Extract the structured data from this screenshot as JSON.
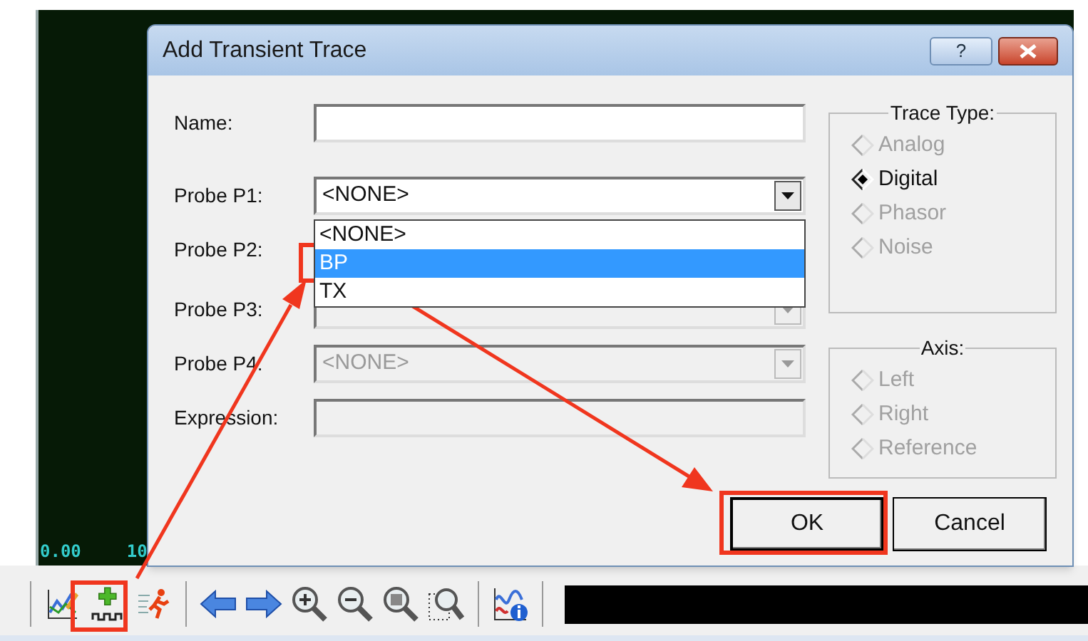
{
  "plot": {
    "x_labels": [
      "0.00",
      "10"
    ]
  },
  "dialog": {
    "title": "Add Transient Trace",
    "help_button": "?",
    "name_field": {
      "label": "Name:"
    },
    "probes": [
      {
        "label": "Probe P1:",
        "value": "<NONE>",
        "disabled": false,
        "expanded": true
      },
      {
        "label": "Probe P2:"
      },
      {
        "label": "Probe P3:",
        "disabled": true,
        "expanded": false
      },
      {
        "label": "Probe P4:",
        "value": "<NONE>",
        "disabled": true,
        "expanded": false
      }
    ],
    "dropdown_options": [
      {
        "label": "<NONE>",
        "selected": false
      },
      {
        "label": "BP",
        "selected": true
      },
      {
        "label": "TX",
        "selected": false
      }
    ],
    "expression_field": {
      "label": "Expression:",
      "disabled": true
    },
    "trace_type": {
      "title": "Trace Type:",
      "options": [
        {
          "label": "Analog",
          "checked": false,
          "disabled": true
        },
        {
          "label": "Digital",
          "checked": true,
          "disabled": false
        },
        {
          "label": "Phasor",
          "checked": false,
          "disabled": true
        },
        {
          "label": "Noise",
          "checked": false,
          "disabled": true
        }
      ]
    },
    "axis": {
      "title": "Axis:",
      "options": [
        {
          "label": "Left",
          "checked": false,
          "disabled": true
        },
        {
          "label": "Right",
          "checked": false,
          "disabled": true
        },
        {
          "label": "Reference",
          "checked": false,
          "disabled": true
        }
      ]
    },
    "buttons": [
      {
        "label": "OK",
        "default": true
      },
      {
        "label": "Cancel",
        "default": false
      }
    ]
  }
}
